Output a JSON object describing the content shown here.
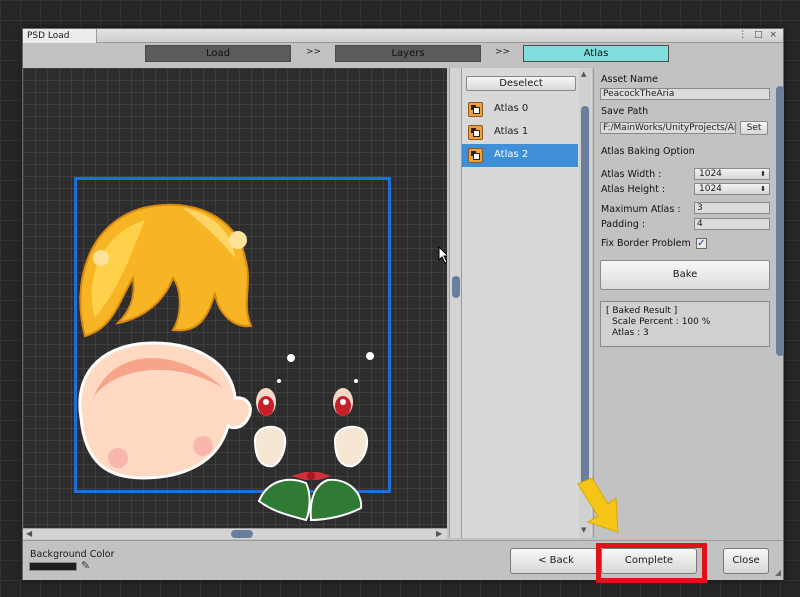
{
  "window": {
    "title": "PSD Load",
    "menu_glyph": "⋮ □ ×"
  },
  "steps": [
    {
      "label": "Load",
      "state": "done"
    },
    {
      "label": "Layers",
      "state": "done"
    },
    {
      "label": "Atlas",
      "state": "active"
    }
  ],
  "step_separator": ">>",
  "atlas_list": {
    "deselect_label": "Deselect",
    "items": [
      {
        "label": "Atlas 0",
        "selected": false
      },
      {
        "label": "Atlas 1",
        "selected": false
      },
      {
        "label": "Atlas 2",
        "selected": true
      }
    ]
  },
  "settings": {
    "asset_name_label": "Asset Name",
    "asset_name_value": "PeacockTheAria",
    "save_path_label": "Save Path",
    "save_path_value": "F:/MainWorks/UnityProjects/Ar",
    "set_label": "Set",
    "baking_option_label": "Atlas Baking Option",
    "atlas_width_label": "Atlas Width :",
    "atlas_width_value": "1024",
    "atlas_height_label": "Atlas Height :",
    "atlas_height_value": "1024",
    "max_atlas_label": "Maximum Atlas :",
    "max_atlas_value": "3",
    "padding_label": "Padding :",
    "padding_value": "4",
    "fix_border_label": "Fix Border Problem",
    "fix_border_checked": true,
    "bake_label": "Bake",
    "result_title": "[ Baked Result ]",
    "result_scale": "Scale Percent : 100 %",
    "result_atlas": "Atlas : 3"
  },
  "bottom": {
    "bg_color_label": "Background Color",
    "bg_color_value": "#1e1e1e",
    "back_label": "< Back",
    "complete_label": "Complete",
    "close_label": "Close"
  },
  "colors": {
    "active_step": "#7fdede",
    "selected_item": "#3e8ed8",
    "atlas_frame": "#1f6fd6",
    "highlight": "#e0111b",
    "pointer_arrow": "#f5c518"
  }
}
